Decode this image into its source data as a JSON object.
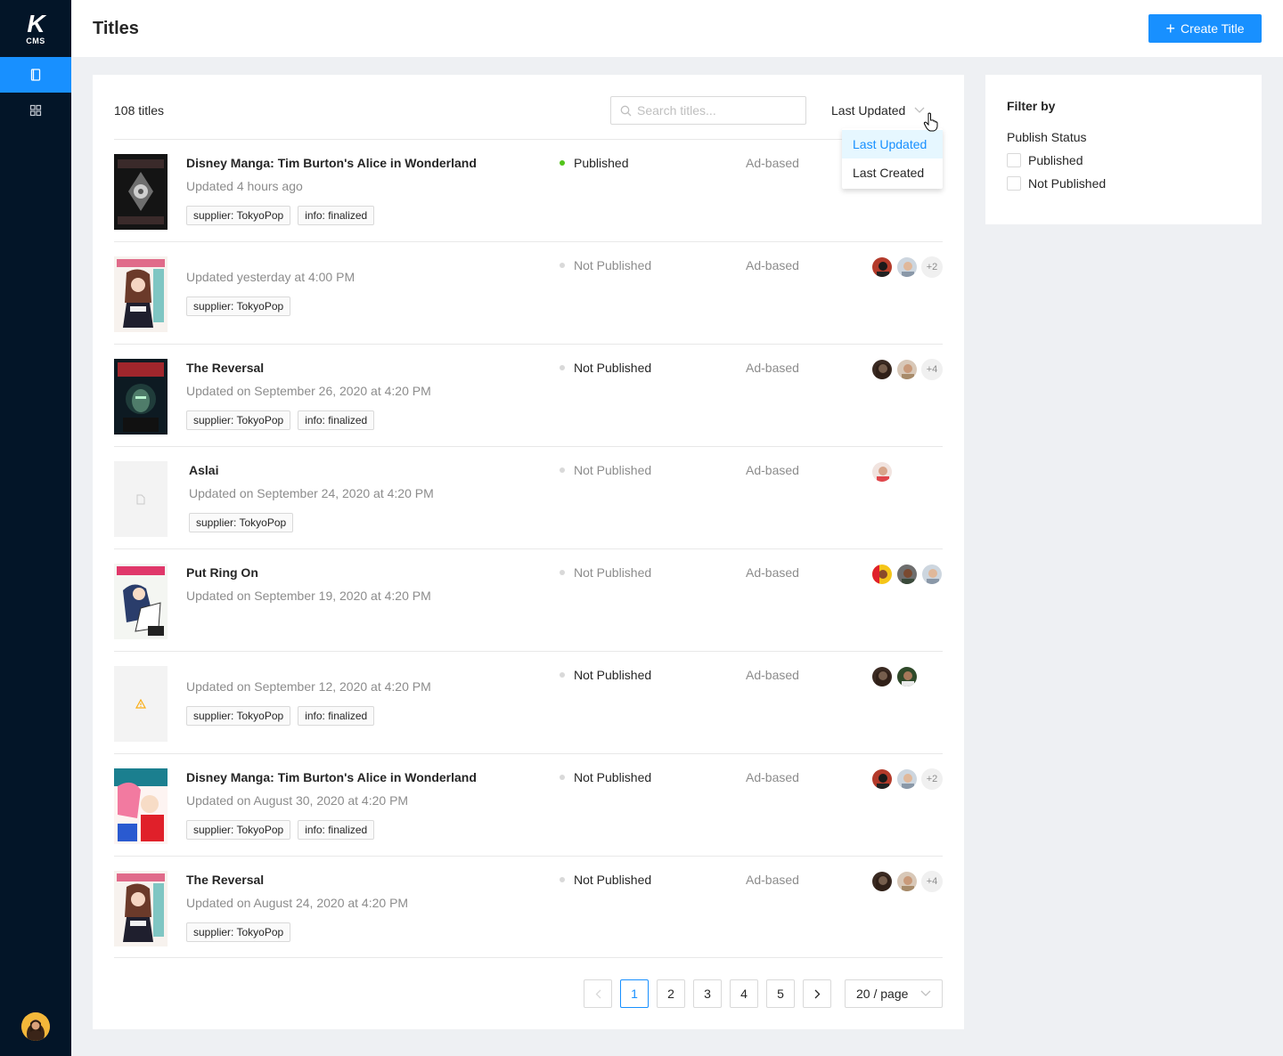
{
  "app": {
    "logo_mark": "K",
    "logo_text": "CMS"
  },
  "sidebar": {
    "items": [
      {
        "icon": "book-icon",
        "active": true
      },
      {
        "icon": "grid-icon",
        "active": false
      }
    ]
  },
  "header": {
    "title": "Titles",
    "create_label": "Create Title"
  },
  "list_toolbar": {
    "count": "108 titles",
    "search_placeholder": "Search titles...",
    "sort_selected": "Last Updated",
    "sort_options": [
      "Last Updated",
      "Last Created"
    ]
  },
  "titles": [
    {
      "name": "Disney Manga: Tim Burton's Alice in Wonderland",
      "updated": "Updated 4 hours ago",
      "tags": [
        "supplier: TokyoPop",
        "info: finalized"
      ],
      "status": "Published",
      "monetization": "Ad-based",
      "more": ""
    },
    {
      "name": "",
      "updated": "Updated yesterday at 4:00 PM",
      "tags": [
        "supplier: TokyoPop"
      ],
      "status": "Not Published",
      "monetization": "Ad-based",
      "more": "+2"
    },
    {
      "name": "The Reversal",
      "updated": "Updated on September 26, 2020 at 4:20 PM",
      "tags": [
        "supplier: TokyoPop",
        "info: finalized"
      ],
      "status": "Not Published",
      "monetization": "Ad-based",
      "more": "+4"
    },
    {
      "name": "Aslai",
      "updated": "Updated on September 24, 2020 at 4:20 PM",
      "tags": [
        "supplier: TokyoPop"
      ],
      "status": "Not Published",
      "monetization": "Ad-based",
      "more": ""
    },
    {
      "name": "Put Ring On",
      "updated": "Updated on September 19, 2020 at 4:20 PM",
      "tags": [],
      "status": "Not Published",
      "monetization": "Ad-based",
      "more": ""
    },
    {
      "name": "",
      "updated": "Updated on September 12, 2020 at 4:20 PM",
      "tags": [
        "supplier: TokyoPop",
        "info: finalized"
      ],
      "status": "Not Published",
      "monetization": "Ad-based",
      "more": ""
    },
    {
      "name": "Disney Manga: Tim Burton's Alice in Wonderland",
      "updated": "Updated on August 30, 2020 at 4:20 PM",
      "tags": [
        "supplier: TokyoPop",
        "info: finalized"
      ],
      "status": "Not Published",
      "monetization": "Ad-based",
      "more": "+2"
    },
    {
      "name": "The Reversal",
      "updated": "Updated on August 24, 2020 at 4:20 PM",
      "tags": [
        "supplier: TokyoPop"
      ],
      "status": "Not Published",
      "monetization": "Ad-based",
      "more": "+4"
    }
  ],
  "pagination": {
    "pages": [
      "1",
      "2",
      "3",
      "4",
      "5"
    ],
    "current": "1",
    "page_size": "20 / page"
  },
  "filter": {
    "title": "Filter by",
    "group_label": "Publish Status",
    "options": [
      "Published",
      "Not Published"
    ]
  },
  "colors": {
    "primary": "#1890ff",
    "sidebar": "#031528",
    "published": "#52c41a",
    "not_published": "#d9d9d9"
  }
}
